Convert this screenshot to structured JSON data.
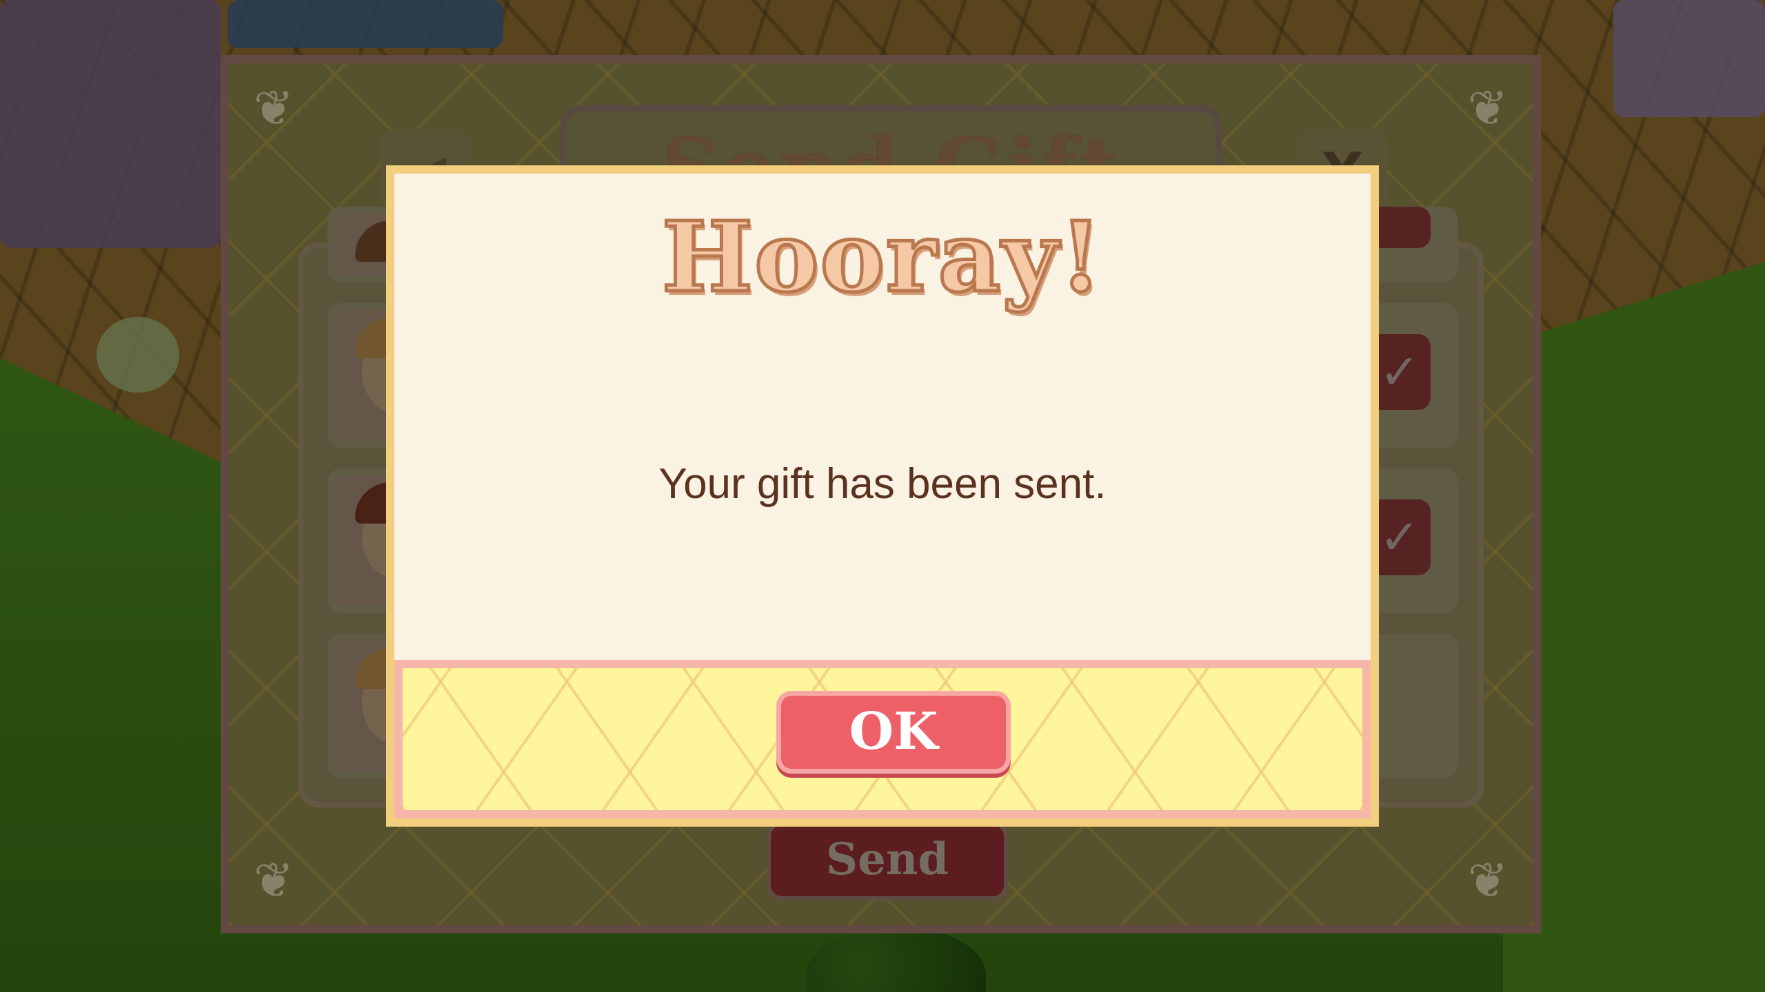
{
  "background_panel": {
    "title": "Send Gift",
    "back_icon": "arrow-left-icon",
    "close_label": "X",
    "send_label": "Send",
    "friends": [
      {
        "hair_color": "#5a3a22",
        "selected": true
      },
      {
        "hair_color": "#8a6a3a",
        "selected": true
      },
      {
        "hair_color": "#5a2a1a",
        "selected": true
      },
      {
        "hair_color": "#8a6a3a",
        "selected": false
      }
    ],
    "check_icon": "checkmark-icon"
  },
  "dialog": {
    "title": "Hooray!",
    "message": "Your gift has been sent.",
    "ok_label": "OK"
  },
  "colors": {
    "dialog_bg": "#faf2e2",
    "dialog_border": "#f2cf7e",
    "footer_bg": "#fff59c",
    "ok_button": "#ee6068",
    "message_text": "#5b3220"
  }
}
